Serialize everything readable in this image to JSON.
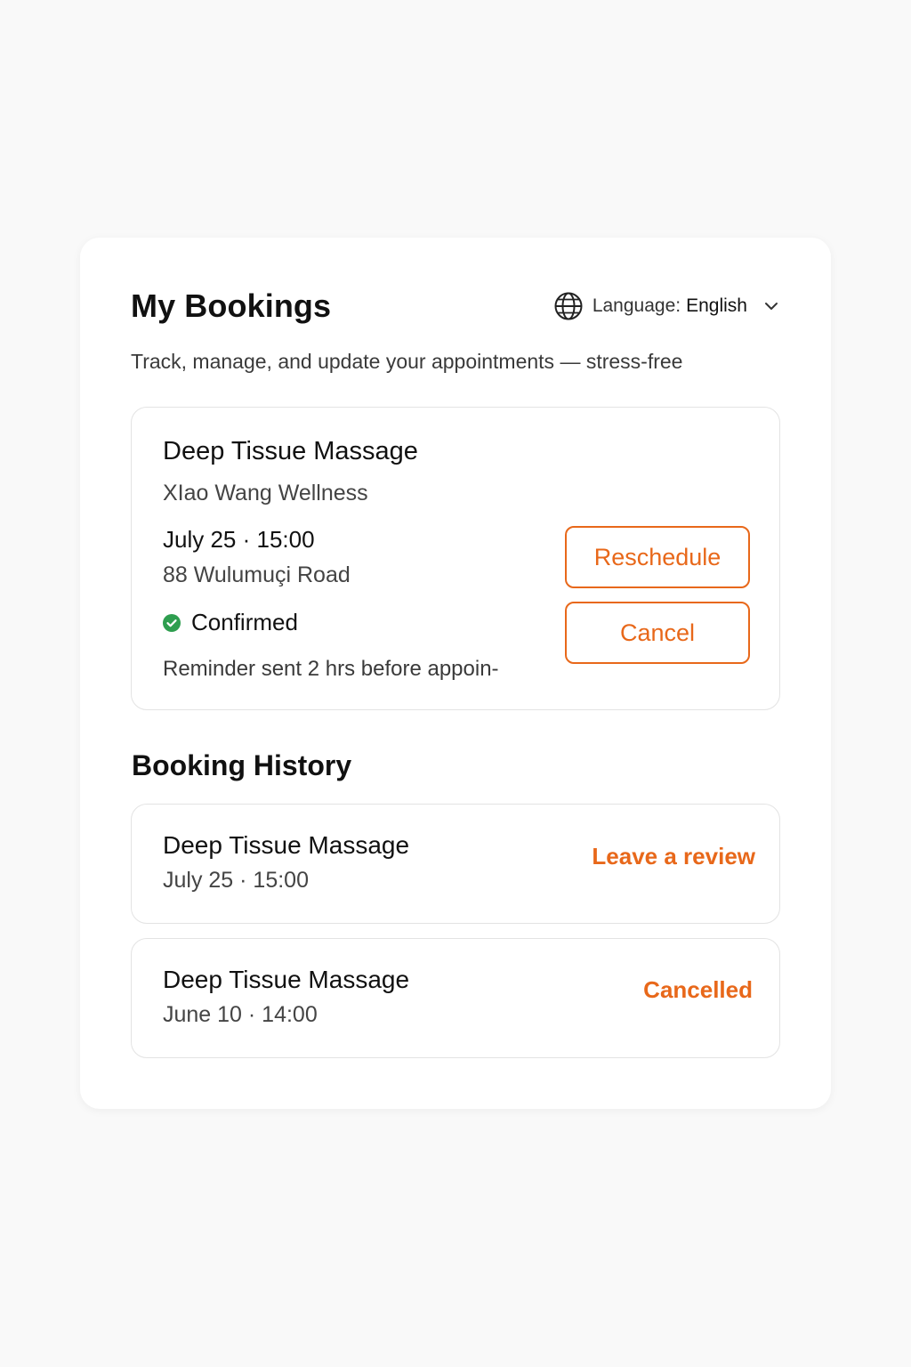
{
  "header": {
    "title": "My Bookings",
    "language_label": "Language:",
    "language_value": "English",
    "subtitle": "Track, manage, and update your appointments — stress-free"
  },
  "active_booking": {
    "service": "Deep Tissue Massage",
    "provider": "XIao Wang Wellness",
    "datetime": "July 25 · 15:00",
    "address": "88 Wulumuçi Road",
    "status": "Confirmed",
    "reminder": "Reminder sent 2 hrs before appoin-",
    "reschedule_label": "Reschedule",
    "cancel_label": "Cancel"
  },
  "history": {
    "title": "Booking History",
    "items": [
      {
        "service": "Deep Tissue Massage",
        "datetime": "July 25 · 15:00",
        "action": "Leave a review"
      },
      {
        "service": "Deep Tissue Massage",
        "datetime": "June 10 · 14:00",
        "action": "Cancelled"
      }
    ]
  },
  "icons": {
    "language": "globe-icon",
    "dropdown": "chevron-down-icon",
    "status": "check-circle-icon"
  },
  "colors": {
    "accent": "#e8681a",
    "success": "#2e9e4f",
    "background": "#f9f9f9",
    "panel": "#ffffff"
  }
}
